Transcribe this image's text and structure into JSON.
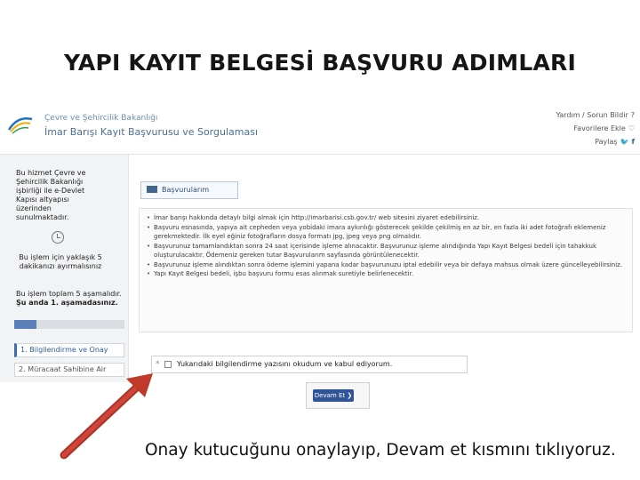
{
  "slide_title": "YAPI KAYIT BELGESİ BAŞVURU ADIMLARI",
  "header": {
    "ministry": "Çevre ve Şehircilik Bakanlığı",
    "portal_title": "İmar Barışı Kayıt Başvurusu ve Sorgulaması",
    "links": {
      "help": "Yardım / Sorun Bildir",
      "favorites": "Favorilere Ekle",
      "share": "Paylaş"
    }
  },
  "sidebar": {
    "info": "Bu hizmet Çevre ve Şehircilik Bakanlığı işbirliği ile e-Devlet Kapısı altyapısı üzerinden sunulmaktadır.",
    "time": "Bu işlem için yaklaşık 5 dakikanızı ayırmalısınız",
    "steps_total": "Bu işlem toplam 5 aşamalıdır.",
    "steps_current": "Şu anda 1. aşamadasınız.",
    "progress": 0.2,
    "steps": [
      "1. Bilgilendirme ve Onay",
      "2. Müracaat Sahibine Air"
    ]
  },
  "main": {
    "tab_label": "Başvurularım",
    "info_items": [
      "İmar barışı hakkında detaylı bilgi almak için http://imarbarisi.csb.gov.tr/ web sitesini ziyaret edebilirsiniz.",
      "Başvuru esnasında, yapıya ait cepheden veya yobidaki imara aykırılığı gösterecek şekilde çekilmiş en az bir, en fazla iki adet fotoğrafı eklemeniz gerekmektedir. İlk eyel eğiniz fotoğrafların dosya formatı jpg, jpeg veya png olmalıdır.",
      "Başvurunuz tamamlandıktan sonra 24 saat içerisinde işleme alınacaktır. Başvurunuz işleme alındığında Yapı Kayıt Belgesi bedeli için tahakkuk oluşturulacaktır. Ödemeniz gereken tutar Başvurularım sayfasında görüntülenecektir.",
      "Başvurunuz işleme alındıktan sonra ödeme işlemini yapana kadar başvurunuzu iptal edebilir veya bir defaya mahsus olmak üzere güncelleyebilirsiniz.",
      "Yapı Kayıt Belgesi bedeli, işbu başvuru formu esas alınmak suretiyle belirlenecektir."
    ],
    "required_mark": "*",
    "consent_label": "Yukarıdaki bilgilendirme yazısını okudum ve kabul ediyorum.",
    "continue_label": "Devam Et ❯"
  },
  "caption": "Onay kutucuğunu onaylayıp, Devam et kısmını tıklıyoruz.",
  "colors": {
    "arrow": "#c0392b",
    "primary_button": "#2f5597",
    "progress_fill": "#5a7fb8"
  }
}
